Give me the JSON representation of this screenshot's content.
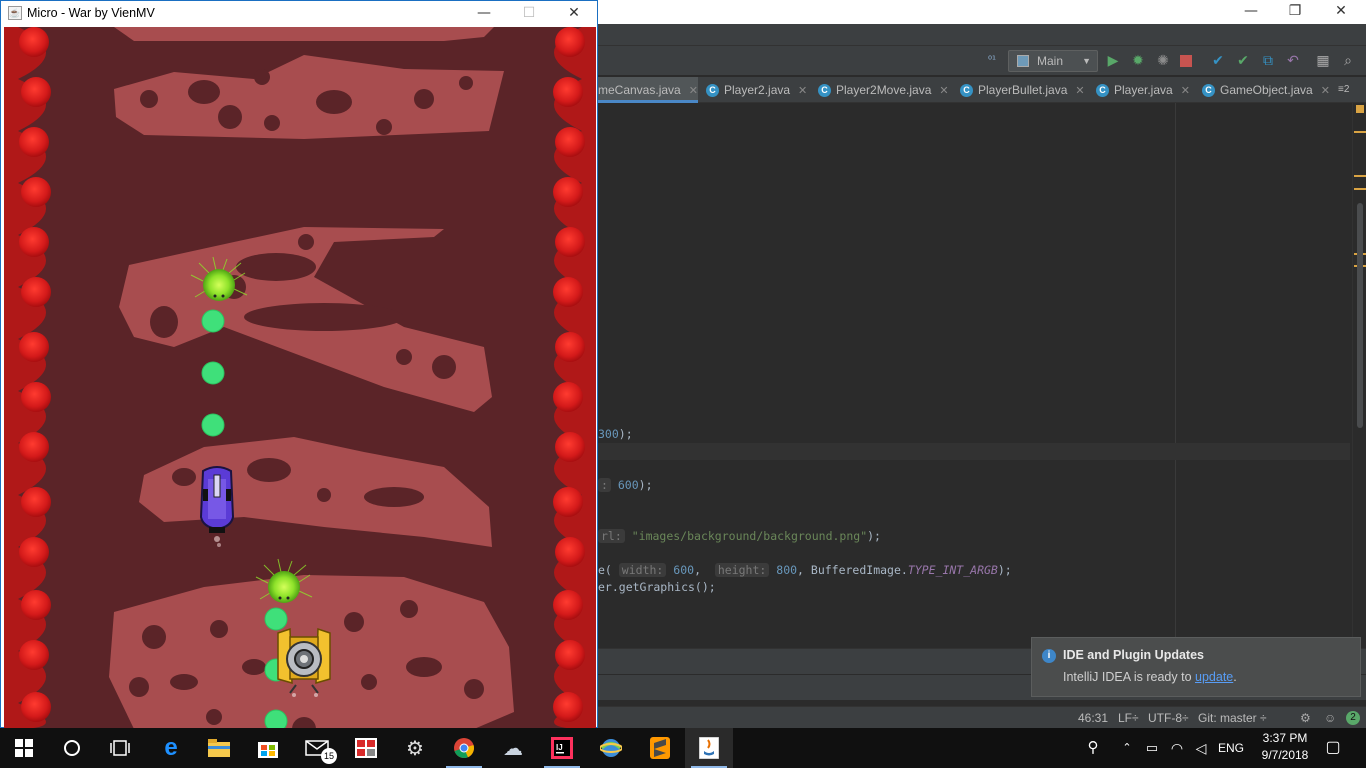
{
  "game": {
    "title": "Micro - War by VienMV",
    "controls": {
      "minimize": "—",
      "maximize": "☐",
      "close": "✕"
    }
  },
  "ide": {
    "window_controls": {
      "minimize": "—",
      "restore": "❐",
      "close": "✕"
    },
    "run_config": "Main",
    "tabs": [
      {
        "label": "meCanvas.java",
        "active": true
      },
      {
        "label": "Player2.java"
      },
      {
        "label": "Player2Move.java"
      },
      {
        "label": "PlayerBullet.java"
      },
      {
        "label": "Player.java"
      },
      {
        "label": "GameObject.java"
      }
    ],
    "tab_overflow": "≡2",
    "code": {
      "line1": {
        "num": "300",
        "tail": ");"
      },
      "line2": {
        "hint": ":",
        "num": "600",
        "tail": ");"
      },
      "line3": {
        "hint": "rl:",
        "str": "\"images/background/background.png\"",
        "tail": ");"
      },
      "line4": {
        "pre": "e(",
        "hint_w": "width:",
        "num_w": "600",
        "sep": ",",
        "hint_h": "height:",
        "num_h": "800",
        "mid": ", BufferedImage.",
        "const": "TYPE_INT_ARGB",
        "tail": ");"
      },
      "line5": {
        "text": "er.getGraphics();"
      }
    },
    "status": {
      "position": "46:31",
      "line_sep": "LF÷",
      "encoding": "UTF-8÷",
      "git": "Git: master ÷",
      "badge": "2"
    },
    "notification": {
      "title": "IDE and Plugin Updates",
      "body": "IntelliJ IDEA is ready to ",
      "link": "update",
      "end": "."
    }
  },
  "taskbar": {
    "mail_badge": "15",
    "language": "ENG",
    "time": "3:37 PM",
    "date": "9/7/2018"
  },
  "colors": {
    "ide_bg": "#2b2b2b",
    "game_bg": "#5b2428",
    "tissue": "#a84d4f",
    "cell_red": "#d41a1a",
    "virus_green": "#8ee22a",
    "bullet_green": "#3fe07a"
  }
}
